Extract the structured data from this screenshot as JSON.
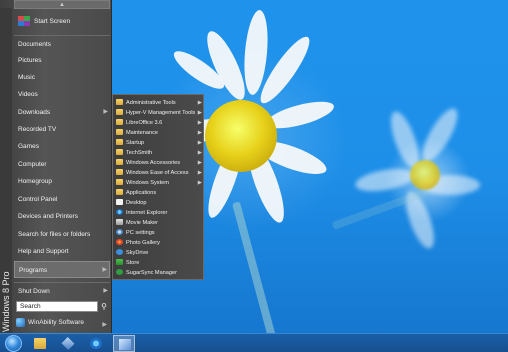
{
  "start_menu": {
    "side_label": "Windows 8 Pro",
    "items": [
      {
        "label": "Start Screen"
      },
      {
        "label": "Documents"
      },
      {
        "label": "Pictures"
      },
      {
        "label": "Music"
      },
      {
        "label": "Videos"
      },
      {
        "label": "Downloads"
      },
      {
        "label": "Recorded TV"
      },
      {
        "label": "Games"
      },
      {
        "label": "Computer"
      },
      {
        "label": "Homegroup"
      },
      {
        "label": "Control Panel"
      },
      {
        "label": "Devices and Printers"
      },
      {
        "label": "Search for files or folders"
      },
      {
        "label": "Help and Support"
      },
      {
        "label": "Programs"
      },
      {
        "label": "Shut Down"
      }
    ],
    "search_placeholder": "Search",
    "footer_label": "WinAbility Software"
  },
  "programs_submenu": {
    "items": [
      {
        "label": "Administrative Tools",
        "icon": "folder-icon",
        "has_submenu": true
      },
      {
        "label": "Hyper-V Management Tools",
        "icon": "folder-icon",
        "has_submenu": true
      },
      {
        "label": "LibreOffice 3.6",
        "icon": "folder-icon",
        "has_submenu": true
      },
      {
        "label": "Maintenance",
        "icon": "folder-icon",
        "has_submenu": true
      },
      {
        "label": "Startup",
        "icon": "folder-icon",
        "has_submenu": true
      },
      {
        "label": "TechSmith",
        "icon": "folder-icon",
        "has_submenu": true
      },
      {
        "label": "Windows Accessories",
        "icon": "folder-icon",
        "has_submenu": true
      },
      {
        "label": "Windows Ease of Access",
        "icon": "folder-icon",
        "has_submenu": true
      },
      {
        "label": "Windows System",
        "icon": "folder-icon",
        "has_submenu": true
      },
      {
        "label": "Applications",
        "icon": "folder-icon",
        "has_submenu": false
      },
      {
        "label": "Desktop",
        "icon": "desktop-icon",
        "has_submenu": false
      },
      {
        "label": "Internet Explorer",
        "icon": "internet-explorer-icon",
        "has_submenu": false
      },
      {
        "label": "Movie Maker",
        "icon": "movie-maker-icon",
        "has_submenu": false
      },
      {
        "label": "PC settings",
        "icon": "pc-settings-icon",
        "has_submenu": false
      },
      {
        "label": "Photo Gallery",
        "icon": "photo-gallery-icon",
        "has_submenu": false
      },
      {
        "label": "SkyDrive",
        "icon": "skydrive-icon",
        "has_submenu": false
      },
      {
        "label": "Store",
        "icon": "store-icon",
        "has_submenu": false
      },
      {
        "label": "SugarSync Manager",
        "icon": "sugarsync-icon",
        "has_submenu": false
      }
    ]
  },
  "taskbar": {
    "buttons": [
      {
        "icon": "start-orb-icon"
      },
      {
        "icon": "file-explorer-icon"
      },
      {
        "icon": "window-switcher-icon"
      },
      {
        "icon": "internet-explorer-icon"
      },
      {
        "icon": "control-panel-icon"
      }
    ]
  },
  "colors": {
    "menu_bg": "#4a4a4a",
    "taskbar_bg": "#1b5fa8",
    "wallpaper": "#1e8fe8"
  }
}
